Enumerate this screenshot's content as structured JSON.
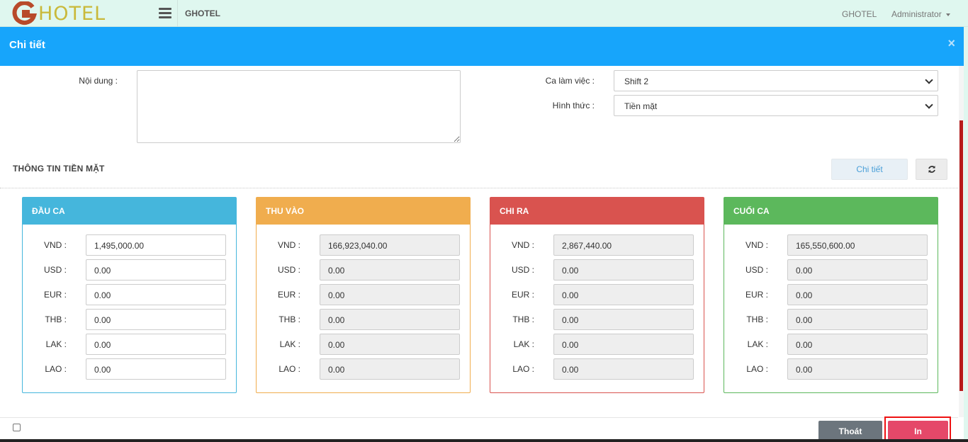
{
  "topbar": {
    "logo_text": "HOTEL",
    "brand": "GHOTEL",
    "right_link": "GHOTEL",
    "user": "Administrator"
  },
  "modal": {
    "title": "Chi tiết",
    "close": "×"
  },
  "form": {
    "content_label": "Nội dung :",
    "shift_label": "Ca làm việc :",
    "shift_value": "Shift 2",
    "method_label": "Hình thức :",
    "method_value": "Tiền mặt"
  },
  "cash": {
    "section_title": "THÔNG TIN TIỀN MẶT",
    "detail_button": "Chi tiết"
  },
  "panels": [
    {
      "title": "ĐẦU CA",
      "color": "#45b6dc",
      "readonly": false,
      "rows": [
        {
          "currency": "VND :",
          "value": "1,495,000.00"
        },
        {
          "currency": "USD :",
          "value": "0.00"
        },
        {
          "currency": "EUR :",
          "value": "0.00"
        },
        {
          "currency": "THB :",
          "value": "0.00"
        },
        {
          "currency": "LAK :",
          "value": "0.00"
        },
        {
          "currency": "LAO :",
          "value": "0.00"
        }
      ]
    },
    {
      "title": "THU VÀO",
      "color": "#f0ad4e",
      "readonly": true,
      "rows": [
        {
          "currency": "VND :",
          "value": "166,923,040.00"
        },
        {
          "currency": "USD :",
          "value": "0.00"
        },
        {
          "currency": "EUR :",
          "value": "0.00"
        },
        {
          "currency": "THB :",
          "value": "0.00"
        },
        {
          "currency": "LAK :",
          "value": "0.00"
        },
        {
          "currency": "LAO :",
          "value": "0.00"
        }
      ]
    },
    {
      "title": "CHI RA",
      "color": "#d9534f",
      "readonly": true,
      "rows": [
        {
          "currency": "VND :",
          "value": "2,867,440.00"
        },
        {
          "currency": "USD :",
          "value": "0.00"
        },
        {
          "currency": "EUR :",
          "value": "0.00"
        },
        {
          "currency": "THB :",
          "value": "0.00"
        },
        {
          "currency": "LAK :",
          "value": "0.00"
        },
        {
          "currency": "LAO :",
          "value": "0.00"
        }
      ]
    },
    {
      "title": "CUỐI CA",
      "color": "#5cb85c",
      "readonly": true,
      "rows": [
        {
          "currency": "VND :",
          "value": "165,550,600.00"
        },
        {
          "currency": "USD :",
          "value": "0.00"
        },
        {
          "currency": "EUR :",
          "value": "0.00"
        },
        {
          "currency": "THB :",
          "value": "0.00"
        },
        {
          "currency": "LAK :",
          "value": "0.00"
        },
        {
          "currency": "LAO :",
          "value": "0.00"
        }
      ]
    }
  ],
  "footer": {
    "exit_button": "Thoát",
    "print_button": "In"
  }
}
